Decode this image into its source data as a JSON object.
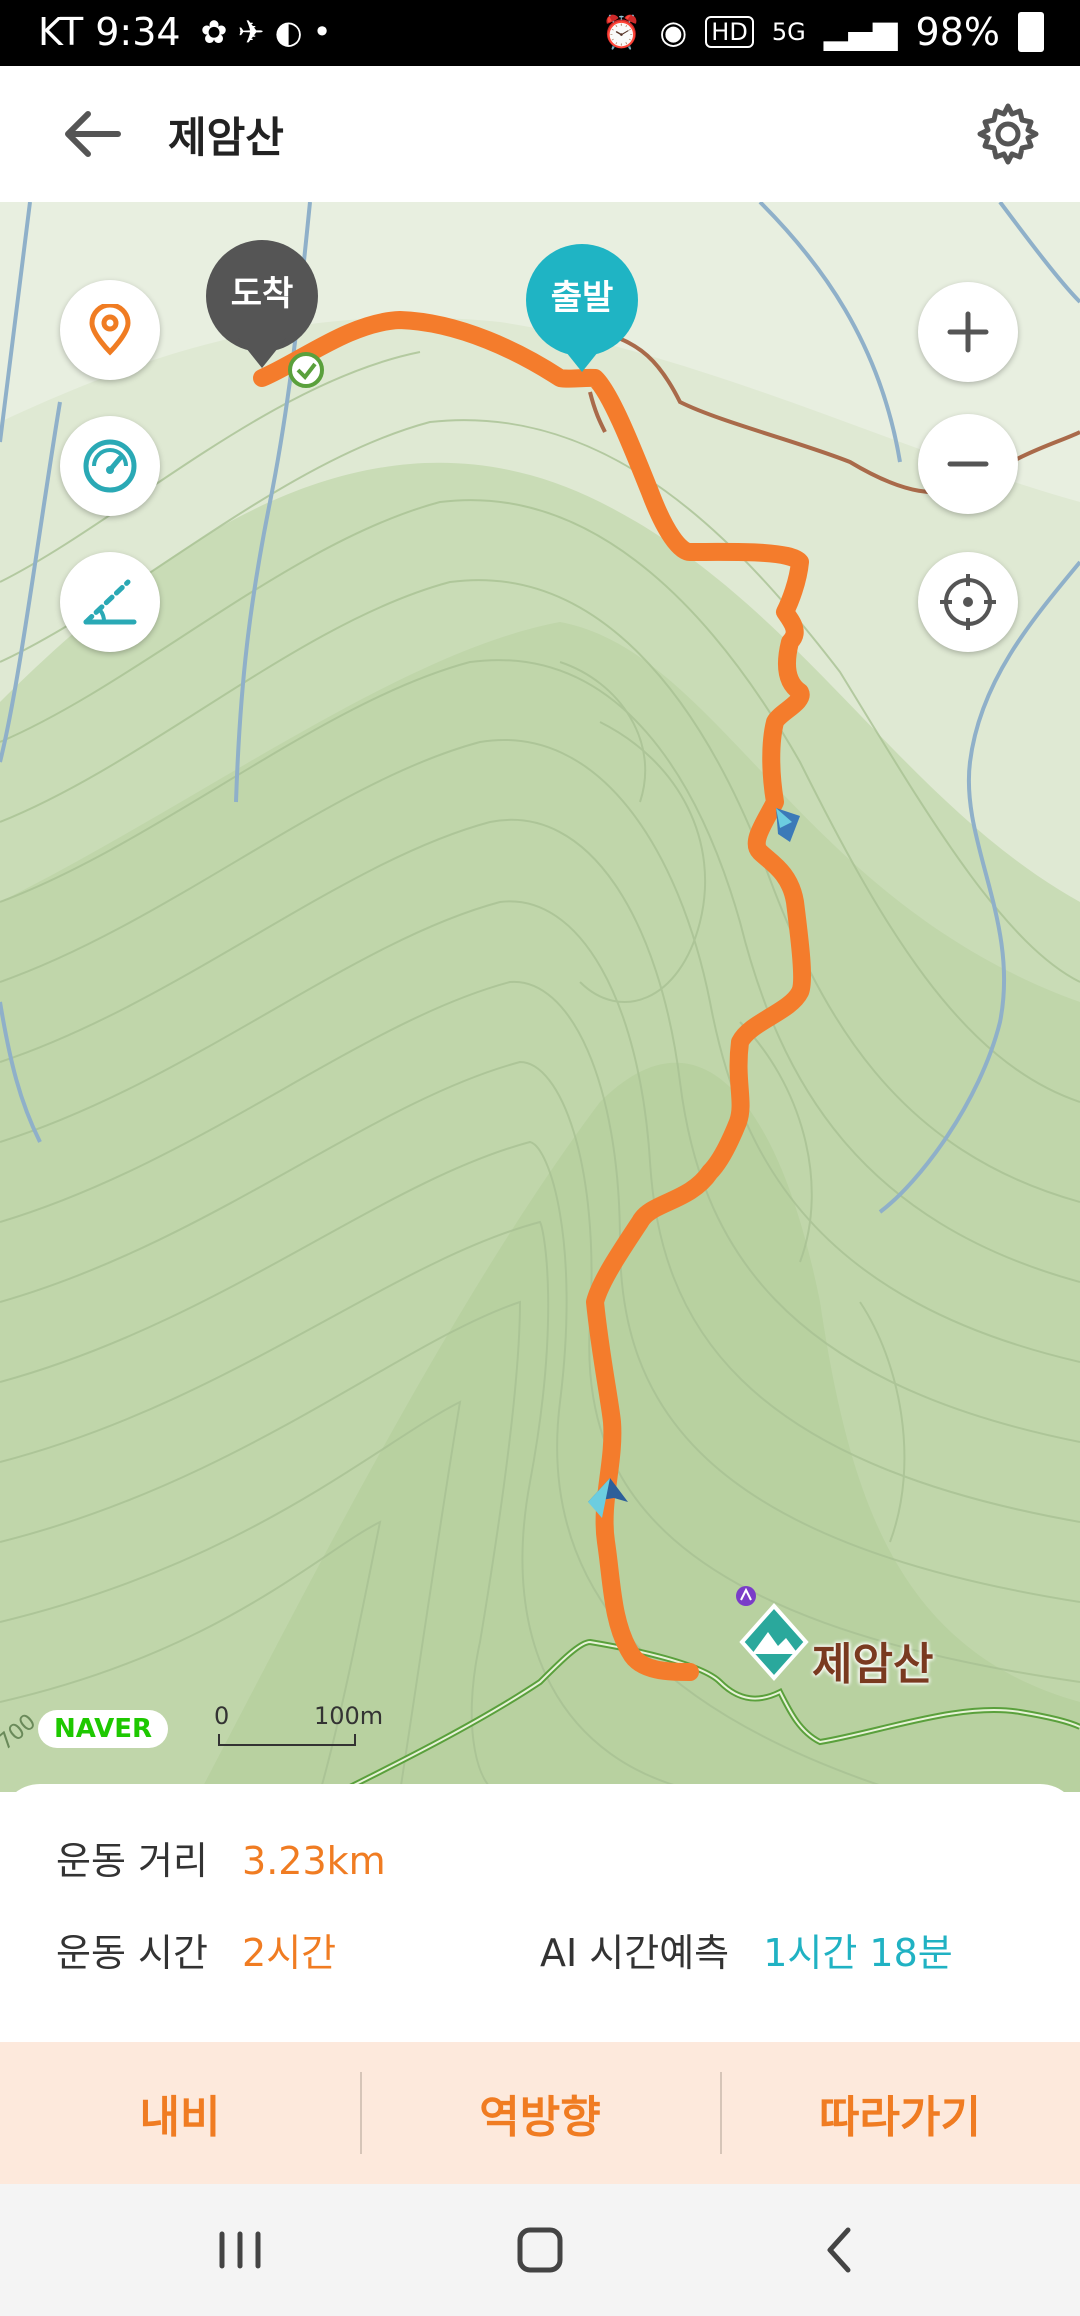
{
  "status_bar": {
    "carrier_time": "KT 9:34",
    "battery": "98%",
    "network": "5G"
  },
  "header": {
    "title": "제암산"
  },
  "map": {
    "pin_arrive": "도착",
    "pin_depart": "출발",
    "peak_name": "제암산",
    "logo": "NAVER",
    "scale_zero": "0",
    "scale_max": "100m",
    "contour_label": "700",
    "route_color": "#f47c2c"
  },
  "stats": {
    "distance_label": "운동 거리",
    "distance_value": "3.23km",
    "time_label": "운동 시간",
    "time_value": "2시간",
    "ai_label": "AI 시간예측",
    "ai_value": "1시간 18분"
  },
  "actions": {
    "navi": "내비",
    "reverse": "역방향",
    "follow": "따라가기"
  },
  "icons": {
    "back": "arrow-left-icon",
    "settings": "gear-icon",
    "location": "map-pin-icon",
    "speed": "speedometer-icon",
    "elevation": "slope-icon",
    "zoom_in": "plus-icon",
    "zoom_out": "minus-icon",
    "recenter": "crosshair-icon"
  }
}
